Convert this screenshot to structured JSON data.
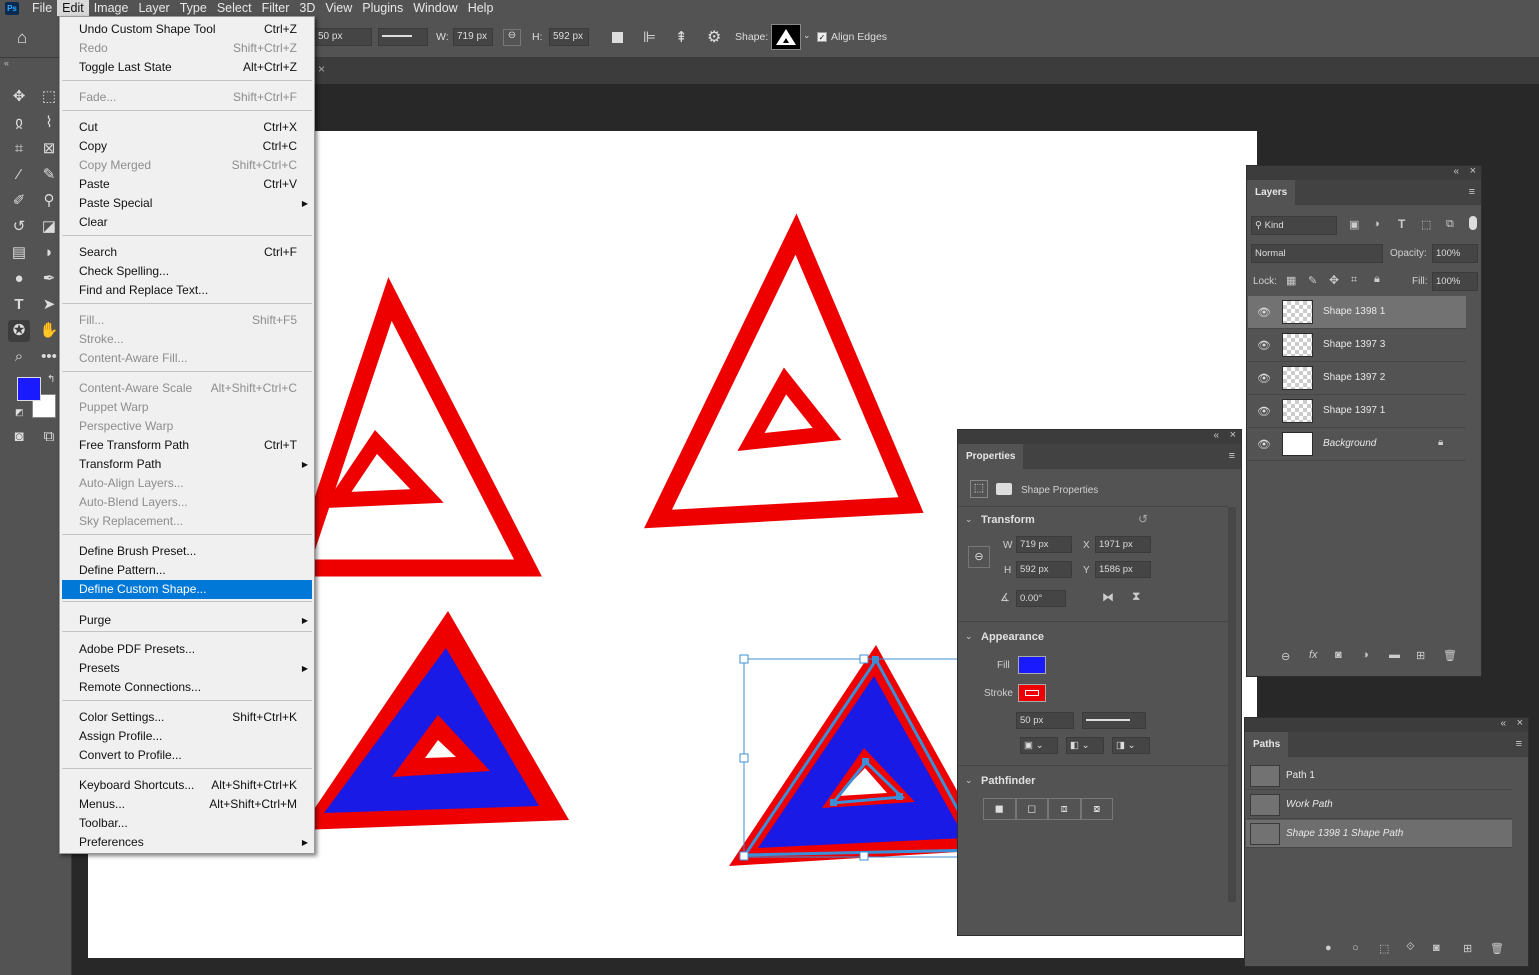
{
  "menubar": {
    "logo": "Ps",
    "items": [
      "File",
      "Edit",
      "Image",
      "Layer",
      "Type",
      "Select",
      "Filter",
      "3D",
      "View",
      "Plugins",
      "Window",
      "Help"
    ]
  },
  "options_bar": {
    "stroke_size": "50 px",
    "w_label": "W:",
    "w_value": "719 px",
    "h_label": "H:",
    "h_value": "592 px",
    "shape_label": "Shape:",
    "align_edges_label": "Align Edges"
  },
  "edit_menu": {
    "items": [
      {
        "label": "Undo Custom Shape Tool",
        "shortcut": "Ctrl+Z",
        "disabled": false
      },
      {
        "label": "Redo",
        "shortcut": "Shift+Ctrl+Z",
        "disabled": true
      },
      {
        "label": "Toggle Last State",
        "shortcut": "Alt+Ctrl+Z",
        "disabled": false
      },
      {
        "label": "Fade...",
        "shortcut": "Shift+Ctrl+F",
        "disabled": true
      },
      {
        "label": "Cut",
        "shortcut": "Ctrl+X",
        "disabled": false
      },
      {
        "label": "Copy",
        "shortcut": "Ctrl+C",
        "disabled": false
      },
      {
        "label": "Copy Merged",
        "shortcut": "Shift+Ctrl+C",
        "disabled": true
      },
      {
        "label": "Paste",
        "shortcut": "Ctrl+V",
        "disabled": false
      },
      {
        "label": "Paste Special",
        "shortcut": "",
        "disabled": false,
        "submenu": true
      },
      {
        "label": "Clear",
        "shortcut": "",
        "disabled": false
      },
      {
        "label": "Search",
        "shortcut": "Ctrl+F",
        "disabled": false
      },
      {
        "label": "Check Spelling...",
        "shortcut": "",
        "disabled": false
      },
      {
        "label": "Find and Replace Text...",
        "shortcut": "",
        "disabled": false
      },
      {
        "label": "Fill...",
        "shortcut": "Shift+F5",
        "disabled": true
      },
      {
        "label": "Stroke...",
        "shortcut": "",
        "disabled": true
      },
      {
        "label": "Content-Aware Fill...",
        "shortcut": "",
        "disabled": true
      },
      {
        "label": "Content-Aware Scale",
        "shortcut": "Alt+Shift+Ctrl+C",
        "disabled": true
      },
      {
        "label": "Puppet Warp",
        "shortcut": "",
        "disabled": true
      },
      {
        "label": "Perspective Warp",
        "shortcut": "",
        "disabled": true
      },
      {
        "label": "Free Transform Path",
        "shortcut": "Ctrl+T",
        "disabled": false
      },
      {
        "label": "Transform Path",
        "shortcut": "",
        "disabled": false,
        "submenu": true
      },
      {
        "label": "Auto-Align Layers...",
        "shortcut": "",
        "disabled": true
      },
      {
        "label": "Auto-Blend Layers...",
        "shortcut": "",
        "disabled": true
      },
      {
        "label": "Sky Replacement...",
        "shortcut": "",
        "disabled": true
      },
      {
        "label": "Define Brush Preset...",
        "shortcut": "",
        "disabled": false
      },
      {
        "label": "Define Pattern...",
        "shortcut": "",
        "disabled": false
      },
      {
        "label": "Define Custom Shape...",
        "shortcut": "",
        "disabled": false,
        "highlighted": true
      },
      {
        "label": "Purge",
        "shortcut": "",
        "disabled": false,
        "submenu": true
      },
      {
        "label": "Adobe PDF Presets...",
        "shortcut": "",
        "disabled": false
      },
      {
        "label": "Presets",
        "shortcut": "",
        "disabled": false,
        "submenu": true
      },
      {
        "label": "Remote Connections...",
        "shortcut": "",
        "disabled": false
      },
      {
        "label": "Color Settings...",
        "shortcut": "Shift+Ctrl+K",
        "disabled": false
      },
      {
        "label": "Assign Profile...",
        "shortcut": "",
        "disabled": false
      },
      {
        "label": "Convert to Profile...",
        "shortcut": "",
        "disabled": false
      },
      {
        "label": "Keyboard Shortcuts...",
        "shortcut": "Alt+Shift+Ctrl+K",
        "disabled": false
      },
      {
        "label": "Menus...",
        "shortcut": "Alt+Shift+Ctrl+M",
        "disabled": false
      },
      {
        "label": "Toolbar...",
        "shortcut": "",
        "disabled": false
      },
      {
        "label": "Preferences",
        "shortcut": "",
        "disabled": false,
        "submenu": true
      }
    ]
  },
  "colors": {
    "foreground": "#1a1aff",
    "background": "#ffffff",
    "shape_stroke": "#ee0000",
    "shape_fill": "#1a1ae6",
    "selection": "#3c8fd6",
    "menu_highlight": "#0078d7"
  },
  "layers_panel": {
    "tab": "Layers",
    "filter_kind": "Kind",
    "blend_mode": "Normal",
    "opacity_label": "Opacity:",
    "opacity_value": "100%",
    "lock_label": "Lock:",
    "fill_label": "Fill:",
    "fill_value": "100%",
    "layers": [
      {
        "name": "Shape 1398 1",
        "selected": true
      },
      {
        "name": "Shape 1397 3",
        "selected": false
      },
      {
        "name": "Shape 1397 2",
        "selected": false
      },
      {
        "name": "Shape 1397 1",
        "selected": false
      },
      {
        "name": "Background",
        "selected": false,
        "locked": true
      }
    ]
  },
  "properties_panel": {
    "tab": "Properties",
    "subtitle": "Shape Properties",
    "transform_heading": "Transform",
    "w_label": "W",
    "w_value": "719 px",
    "x_label": "X",
    "x_value": "1971 px",
    "h_label": "H",
    "h_value": "592 px",
    "y_label": "Y",
    "y_value": "1586 px",
    "angle_value": "0.00°",
    "appearance_heading": "Appearance",
    "fill_label": "Fill",
    "stroke_label": "Stroke",
    "stroke_size": "50 px",
    "pathfinder_heading": "Pathfinder"
  },
  "paths_panel": {
    "tab": "Paths",
    "paths": [
      {
        "name": "Path 1",
        "italic": false,
        "selected": false
      },
      {
        "name": "Work Path",
        "italic": true,
        "selected": false
      },
      {
        "name": "Shape 1398 1 Shape Path",
        "italic": true,
        "selected": true
      }
    ]
  }
}
